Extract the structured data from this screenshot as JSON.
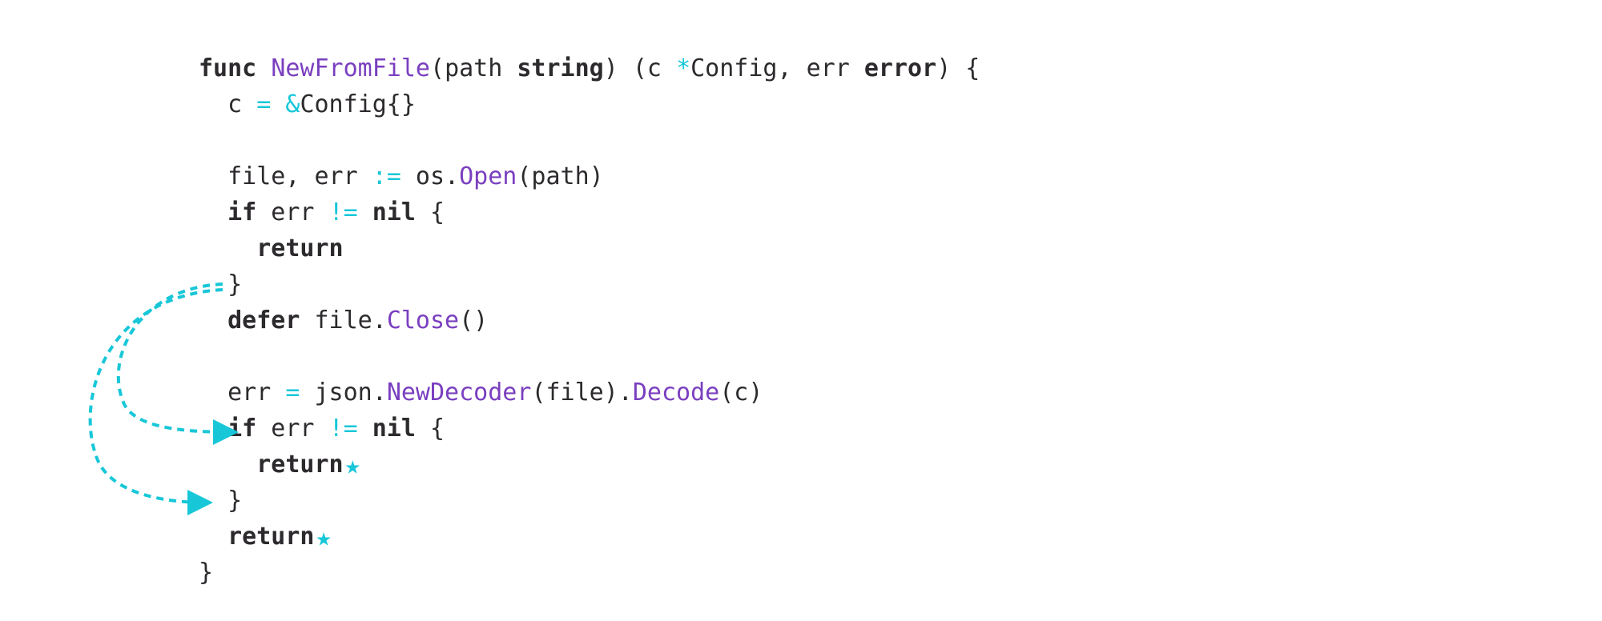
{
  "code": {
    "l1": {
      "kw_func": "func",
      "fn": "NewFromFile",
      "open_paren": "(",
      "param": "path ",
      "type_string": "string",
      "close_paren": ")",
      "ret_open": " (c ",
      "star": "*",
      "ret_cfg": "Config, err ",
      "ret_err": "error",
      "ret_close": ") {"
    },
    "l2": {
      "indent": "  ",
      "var": "c ",
      "eq": "=",
      "amp": " &",
      "rest": "Config{}"
    },
    "l3": "",
    "l4": {
      "indent": "  ",
      "lhs": "file, err ",
      "assign": ":=",
      "pkg": " os.",
      "meth": "Open",
      "args": "(path)"
    },
    "l5": {
      "indent": "  ",
      "kw_if": "if",
      "mid": " err ",
      "neq": "!=",
      "sp": " ",
      "nil": "nil",
      "brace": " {"
    },
    "l6": {
      "indent": "    ",
      "ret": "return"
    },
    "l7": {
      "indent": "  ",
      "brace": "}"
    },
    "l8": {
      "indent": "  ",
      "kw_defer": "defer",
      "mid": " file.",
      "meth": "Close",
      "parens": "()"
    },
    "l9": "",
    "l10": {
      "indent": "  ",
      "lhs": "err ",
      "eq": "=",
      "pkg": " json.",
      "meth1": "NewDecoder",
      "mid": "(file).",
      "meth2": "Decode",
      "args": "(c)"
    },
    "l11": {
      "indent": "  ",
      "kw_if": "if",
      "mid": " err ",
      "neq": "!=",
      "sp": " ",
      "nil": "nil",
      "brace": " {"
    },
    "l12": {
      "indent": "    ",
      "ret": "return",
      "star": "★"
    },
    "l13": {
      "indent": "  ",
      "brace": "}"
    },
    "l14": {
      "indent": "  ",
      "ret": "return",
      "star": "★"
    },
    "l15": {
      "brace": "}"
    }
  },
  "colors": {
    "accent": "#17c7d8",
    "fn": "#7a3fbf",
    "text": "#2d2a2e"
  },
  "arrows": {
    "from": "defer-line",
    "to": [
      "first-return-star",
      "second-return-star"
    ]
  }
}
